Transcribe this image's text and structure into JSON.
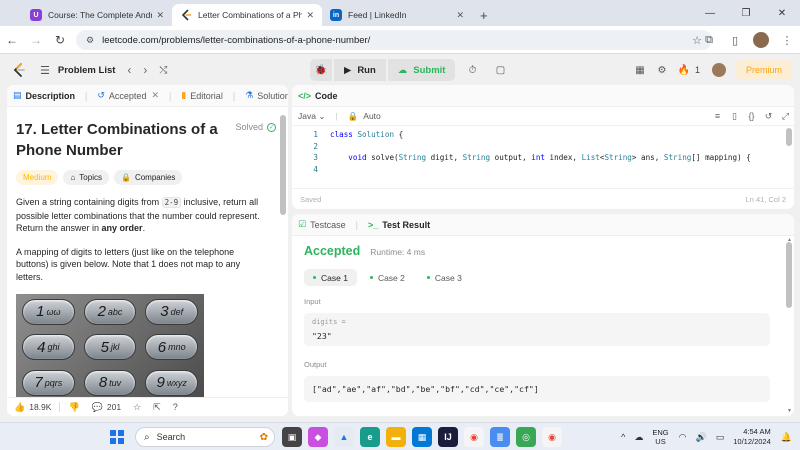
{
  "browser": {
    "tabs": [
      {
        "title": "Course: The Complete Android",
        "favicon": "purple",
        "active": false
      },
      {
        "title": "Letter Combinations of a Phone",
        "favicon": "leetcode",
        "active": true
      },
      {
        "title": "Feed | LinkedIn",
        "favicon": "linkedin",
        "active": false
      }
    ],
    "url": "leetcode.com/problems/letter-combinations-of-a-phone-number/"
  },
  "header": {
    "problem_list": "Problem List",
    "run_label": "Run",
    "submit_label": "Submit",
    "streak_count": "1",
    "premium_label": "Premium"
  },
  "left_tabs": {
    "description": "Description",
    "accepted": "Accepted",
    "editorial": "Editorial",
    "solutions": "Solutions"
  },
  "problem": {
    "title": "17. Letter Combinations of a Phone Number",
    "status": "Solved",
    "difficulty": "Medium",
    "topics_label": "Topics",
    "companies_label": "Companies",
    "para1_a": "Given a string containing digits from ",
    "para1_code": "2-9",
    "para1_b": " inclusive, return all possible letter combinations that the number could represent. Return the answer in ",
    "para1_bold": "any order",
    "para1_c": ".",
    "para2": "A mapping of digits to letters (just like on the telephone buttons) is given below. Note that 1 does not map to any letters.",
    "keypad": [
      {
        "num": "1",
        "letters": "ωω"
      },
      {
        "num": "2",
        "letters": "abc"
      },
      {
        "num": "3",
        "letters": "def"
      },
      {
        "num": "4",
        "letters": "ghi"
      },
      {
        "num": "5",
        "letters": "jkl"
      },
      {
        "num": "6",
        "letters": "mno"
      },
      {
        "num": "7",
        "letters": "pqrs"
      },
      {
        "num": "8",
        "letters": "tuv"
      },
      {
        "num": "9",
        "letters": "wxyz"
      }
    ]
  },
  "left_footer": {
    "likes": "18.9K",
    "comments": "201"
  },
  "code": {
    "tab_label": "Code",
    "language": "Java",
    "mode": "Auto",
    "lines": [
      {
        "n": "1",
        "text": "class Solution {"
      },
      {
        "n": "2",
        "text": ""
      },
      {
        "n": "3",
        "text": "    void solve(String digit, String output, int index, List<String> ans, String[] mapping) {"
      },
      {
        "n": "4",
        "text": ""
      }
    ],
    "saved": "Saved",
    "cursor": "Ln 41, Col 2"
  },
  "result": {
    "testcase_tab": "Testcase",
    "result_tab": "Test Result",
    "verdict": "Accepted",
    "runtime": "Runtime: 4 ms",
    "cases": [
      "Case 1",
      "Case 2",
      "Case 3"
    ],
    "input_label": "Input",
    "input_var": "digits =",
    "input_value": "\"23\"",
    "output_label": "Output",
    "output_value": "[\"ad\",\"ae\",\"af\",\"bd\",\"be\",\"bf\",\"cd\",\"ce\",\"cf\"]"
  },
  "taskbar": {
    "search_placeholder": "Search",
    "lang_top": "ENG",
    "lang_bottom": "US",
    "time": "4:54 AM",
    "date": "10/12/2024"
  },
  "colors": {
    "accepted_green": "#2db55d",
    "leetcode_orange": "#ffa116",
    "medium_yellow": "#ffb800"
  }
}
